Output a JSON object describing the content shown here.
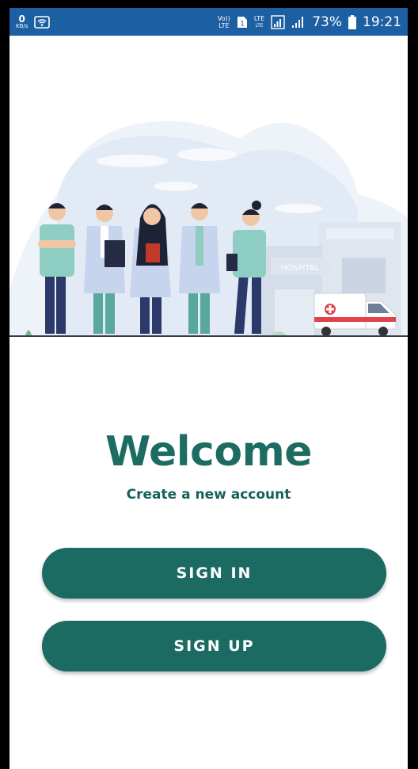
{
  "status_bar": {
    "net_speed_value": "0",
    "net_speed_unit": "KB/s",
    "volte_top": "Vo))",
    "volte_bottom": "LTE",
    "sim_label": "1",
    "lte_top": "LTE",
    "lte_bottom": "LTE",
    "battery_percent": "73%",
    "time": "19:21"
  },
  "illustration": {
    "hospital_sign": "HOSPITAL"
  },
  "welcome": {
    "title": "Welcome",
    "subtitle": "Create a new account"
  },
  "buttons": {
    "sign_in": "SIGN IN",
    "sign_up": "SIGN UP"
  },
  "colors": {
    "primary": "#1b6b62",
    "status_bar": "#1d5fa3",
    "title": "#1c6c63"
  }
}
